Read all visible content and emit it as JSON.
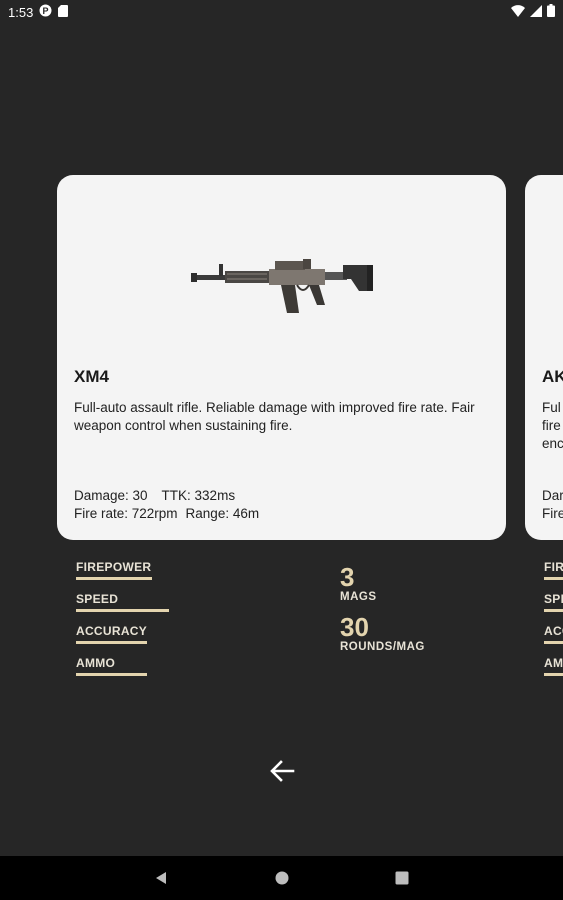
{
  "status_bar": {
    "time": "1:53",
    "icons": [
      "notification-p-icon",
      "sd-card-icon",
      "wifi-icon",
      "signal-icon",
      "battery-icon"
    ]
  },
  "cards": [
    {
      "name": "XM4",
      "image": "assault-rifle-image",
      "description": "Full-auto assault rifle. Reliable damage with improved fire rate. Fair weapon control when sustaining fire.",
      "stats_line1": {
        "damage": "Damage: 30",
        "ttk": "TTK: 332ms"
      },
      "stats_line2": {
        "fire_rate": "Fire rate: 722rpm",
        "range": "Range: 46m"
      }
    },
    {
      "name": "AK",
      "description_lines": [
        "Ful",
        "fire",
        "enc"
      ],
      "stats_lines": [
        "Dar",
        "Fire"
      ]
    }
  ],
  "attributes": [
    {
      "label": "FIREPOWER",
      "level": 0.6
    },
    {
      "label": "SPEED",
      "level": 0.74
    },
    {
      "label": "ACCURACY",
      "level": 0.56
    },
    {
      "label": "AMMO",
      "level": 0.56
    }
  ],
  "peek_attributes": [
    "FIR",
    "SPE",
    "ACC",
    "AMI"
  ],
  "counts": {
    "mags_value": "3",
    "mags_label": "MAGS",
    "rounds_value": "30",
    "rounds_label": "ROUNDS/MAG"
  },
  "colors": {
    "background": "#262626",
    "card": "#f4f4f4",
    "accent": "#e3d4ae"
  },
  "nav": {
    "back_icon": "arrow-left-icon",
    "system_buttons": [
      "nav-back-icon",
      "nav-home-icon",
      "nav-recents-icon"
    ]
  }
}
